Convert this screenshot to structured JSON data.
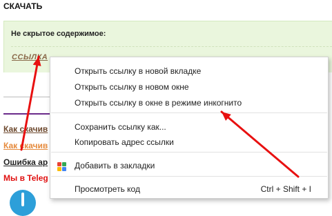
{
  "page": {
    "heading": "СКАЧАТЬ",
    "hidden_box": {
      "title": "Не скрытое содержимое:",
      "link": "ССЫЛКА"
    },
    "links": [
      "Как скачив",
      "Как скачив",
      "Ошибка ар"
    ],
    "telegram": "Мы в Teleg"
  },
  "context_menu": {
    "items": [
      {
        "label": "Открыть ссылку в новой вкладке"
      },
      {
        "label": "Открыть ссылку в новом окне"
      },
      {
        "label": "Открыть ссылку в окне в режиме инкогнито"
      },
      {
        "label": "Сохранить ссылку как..."
      },
      {
        "label": "Копировать адрес ссылки"
      },
      {
        "label": "Добавить в закладки",
        "icon": "bookmark-add-icon"
      },
      {
        "label": "Просмотреть код",
        "shortcut": "Ctrl + Shift + I"
      }
    ]
  },
  "annotation_color": "#e81010"
}
